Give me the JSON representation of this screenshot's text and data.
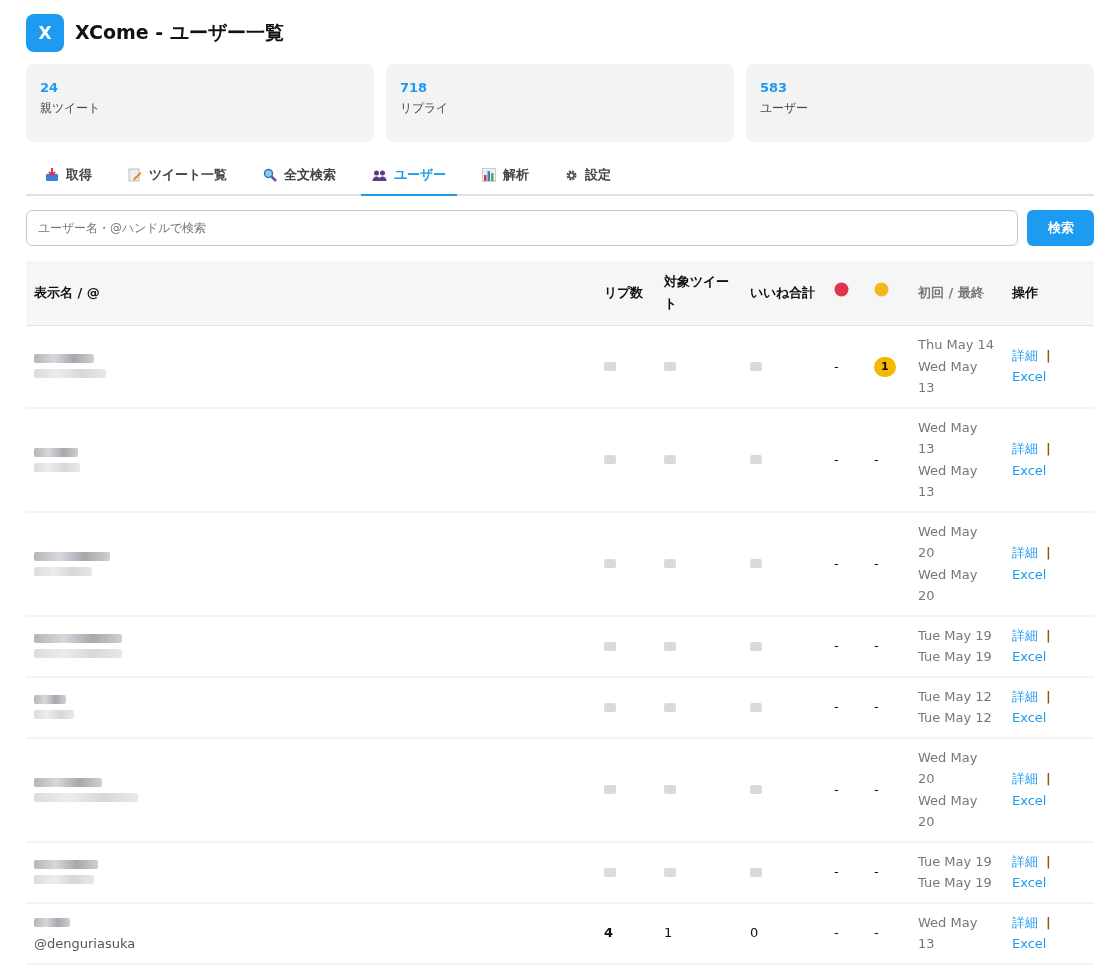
{
  "header": {
    "logo": "X",
    "title": "XCome - ユーザー一覧"
  },
  "stats": [
    {
      "value": "24",
      "label": "親ツイート"
    },
    {
      "value": "718",
      "label": "リプライ"
    },
    {
      "value": "583",
      "label": "ユーザー"
    }
  ],
  "tabs": [
    {
      "label": "取得",
      "selected": false
    },
    {
      "label": "ツイート一覧",
      "selected": false
    },
    {
      "label": "全文検索",
      "selected": false
    },
    {
      "label": "ユーザー",
      "selected": true
    },
    {
      "label": "解析",
      "selected": false
    },
    {
      "label": "設定",
      "selected": false
    }
  ],
  "search": {
    "placeholder": "ユーザー名・@ハンドルで検索",
    "button": "検索"
  },
  "table": {
    "columns": [
      {
        "kind": "text",
        "label": "表示名 / @"
      },
      {
        "kind": "text",
        "label": "リプ数"
      },
      {
        "kind": "text",
        "label": "対象ツイート"
      },
      {
        "kind": "text",
        "label": "いいね合計"
      },
      {
        "kind": "icon",
        "color": "#e0344f"
      },
      {
        "kind": "icon",
        "color": "#f2b824"
      },
      {
        "kind": "text",
        "label": "初回 / 最終"
      },
      {
        "kind": "text",
        "label": "操作"
      }
    ],
    "rows": [
      {
        "red": "-",
        "yellow_badge": "1",
        "first": "Thu May 14",
        "last": "Wed May 13",
        "detail": "詳細",
        "sep": "|",
        "excel": "Excel"
      },
      {
        "red": "-",
        "yellow": "-",
        "first": "Wed May 13",
        "last": "Wed May 13",
        "detail": "詳細",
        "sep": "|",
        "excel": "Excel"
      },
      {
        "red": "-",
        "yellow": "-",
        "first": "Wed May 20",
        "last": "Wed May 20",
        "detail": "詳細",
        "sep": "|",
        "excel": "Excel"
      },
      {
        "red": "-",
        "yellow": "-",
        "first": "Tue May 19",
        "last": "Tue May 19",
        "detail": "詳細",
        "sep": "|",
        "excel": "Excel"
      },
      {
        "red": "-",
        "yellow": "-",
        "first": "Tue May 12",
        "last": "Tue May 12",
        "detail": "詳細",
        "sep": "|",
        "excel": "Excel"
      },
      {
        "red": "-",
        "yellow": "-",
        "first": "Wed May 20",
        "last": "Wed May 20",
        "detail": "詳細",
        "sep": "|",
        "excel": "Excel"
      },
      {
        "red": "-",
        "yellow": "-",
        "first": "Tue May 19",
        "last": "Tue May 19",
        "detail": "詳細",
        "sep": "|",
        "excel": "Excel"
      },
      {
        "handle": "@denguriasuka",
        "replies": "4",
        "targets": "1",
        "likes": "0",
        "red": "-",
        "yellow": "-",
        "first": "Wed May 13",
        "detail": "詳細",
        "sep": "|",
        "excel": "Excel"
      }
    ]
  }
}
